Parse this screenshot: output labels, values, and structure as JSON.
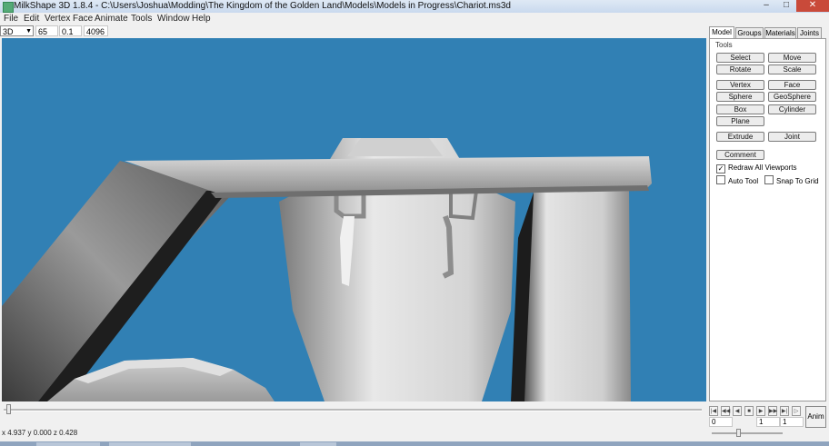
{
  "window": {
    "title": "MilkShape 3D 1.8.4 - C:\\Users\\Joshua\\Modding\\The Kingdom of the Golden Land\\Models\\Models in Progress\\Chariot.ms3d",
    "minimize": "–",
    "maximize": "□",
    "close": "✕"
  },
  "menu": [
    "File",
    "Edit",
    "Vertex",
    "Face",
    "Animate",
    "Tools",
    "Window",
    "Help"
  ],
  "viewport_toolbar": {
    "view_mode": "3D",
    "field_1": "65",
    "field_2": "0.1",
    "field_3": "4096"
  },
  "status": {
    "coords": "x 4.937 y 0.000 z 0.428"
  },
  "panel": {
    "tabs": [
      "Model",
      "Groups",
      "Materials",
      "Joints"
    ],
    "active_tab": "Model",
    "group_label": "Tools",
    "buttons": {
      "select": "Select",
      "move": "Move",
      "rotate": "Rotate",
      "scale": "Scale",
      "vertex": "Vertex",
      "face": "Face",
      "sphere": "Sphere",
      "geosphere": "GeoSphere",
      "box": "Box",
      "cylinder": "Cylinder",
      "plane": "Plane",
      "extrude": "Extrude",
      "joint": "Joint",
      "comment": "Comment"
    },
    "checkboxes": {
      "redraw_all": {
        "label": "Redraw All Viewports",
        "checked": true
      },
      "auto_tool": {
        "label": "Auto Tool",
        "checked": false
      },
      "snap_to_grid": {
        "label": "Snap To Grid",
        "checked": false
      }
    }
  },
  "animation": {
    "frame": "0",
    "current_frame": "1",
    "total_frames": "1",
    "anim_button": "Anim"
  },
  "colors": {
    "viewport_bg": "#3180b4",
    "panel_bg": "#f0f0f0",
    "close_button": "#c94a3a"
  }
}
